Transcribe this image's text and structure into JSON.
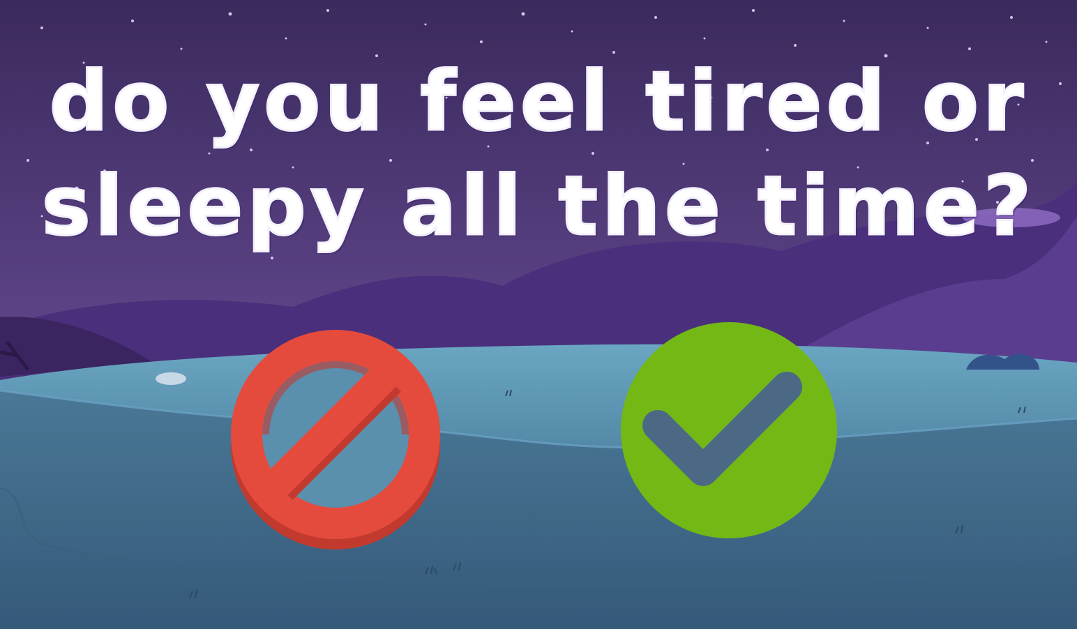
{
  "question": {
    "line1": "do you feel tired or",
    "line2": "sleepy all the time?"
  },
  "answers": {
    "no": {
      "icon": "prohibited-icon",
      "color": "#e54b3d",
      "shade": "#c23a2e"
    },
    "yes": {
      "icon": "checkmark-icon",
      "color": "#74b816",
      "check_color": "#4b6985"
    }
  },
  "scene": {
    "sky_top": "#3d2a60",
    "sky_bottom": "#7a5aa6",
    "hills": "#4b2d7e",
    "lake": "#4f89a8",
    "ground": "#3e6684"
  }
}
